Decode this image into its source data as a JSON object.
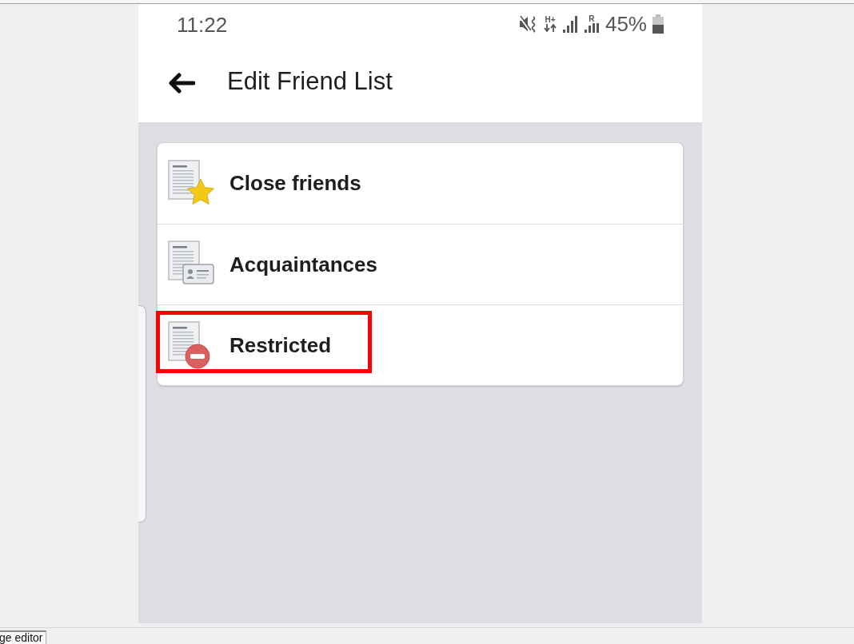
{
  "status_bar": {
    "time": "11:22",
    "data_label": "H+",
    "roaming_label": "R",
    "battery": "45%"
  },
  "header": {
    "title": "Edit Friend List"
  },
  "friend_lists": [
    {
      "label": "Close friends",
      "kind": "star",
      "highlighted": false
    },
    {
      "label": "Acquaintances",
      "kind": "card",
      "highlighted": false
    },
    {
      "label": "Restricted",
      "kind": "restricted",
      "highlighted": true
    }
  ],
  "taskbar": {
    "tab": "ge editor"
  }
}
